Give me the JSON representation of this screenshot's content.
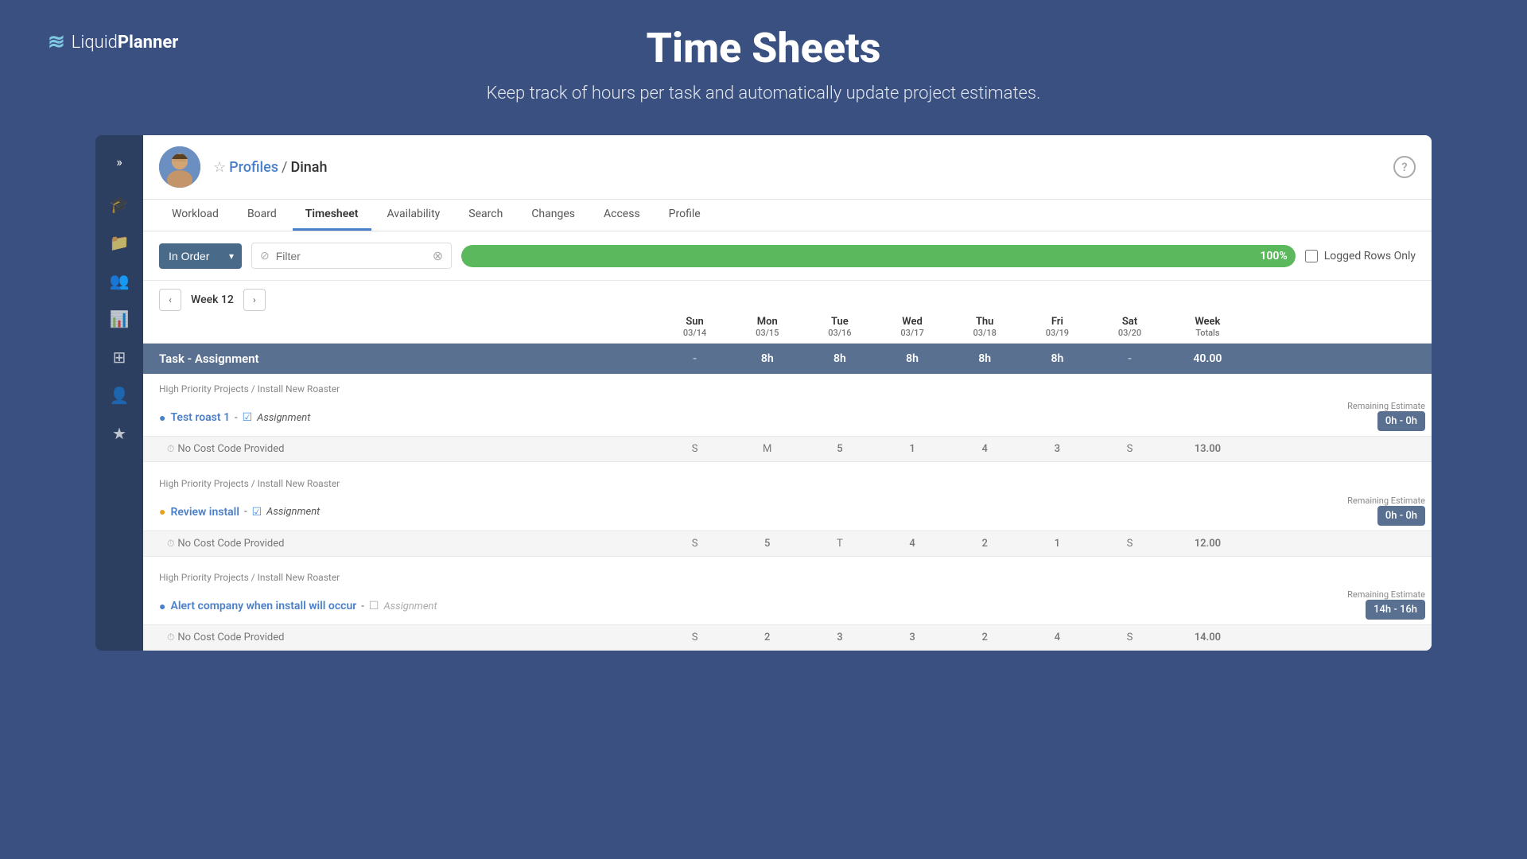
{
  "logo": {
    "waves": "≋",
    "liquid": "Liquid",
    "planner": "Planner"
  },
  "hero": {
    "title": "Time Sheets",
    "subtitle": "Keep track of hours per task and automatically update project estimates."
  },
  "sidebar": {
    "chevron": "»",
    "icons": [
      "🎓",
      "📁",
      "👥",
      "📊",
      "⊞",
      "👤",
      "★"
    ]
  },
  "profile": {
    "breadcrumb_profiles": "Profiles",
    "breadcrumb_sep": "/",
    "breadcrumb_name": "Dinah"
  },
  "tabs": [
    {
      "label": "Workload",
      "active": false
    },
    {
      "label": "Board",
      "active": false
    },
    {
      "label": "Timesheet",
      "active": true
    },
    {
      "label": "Availability",
      "active": false
    },
    {
      "label": "Search",
      "active": false
    },
    {
      "label": "Changes",
      "active": false
    },
    {
      "label": "Access",
      "active": false
    },
    {
      "label": "Profile",
      "active": false
    }
  ],
  "toolbar": {
    "order_label": "In Order",
    "filter_placeholder": "Filter",
    "progress": 100,
    "progress_label": "100%",
    "logged_rows_label": "Logged Rows Only"
  },
  "week": {
    "label": "Week 12",
    "days": [
      {
        "name": "Sun",
        "date": "03/14"
      },
      {
        "name": "Mon",
        "date": "03/15"
      },
      {
        "name": "Tue",
        "date": "03/16"
      },
      {
        "name": "Wed",
        "date": "03/17"
      },
      {
        "name": "Thu",
        "date": "03/18"
      },
      {
        "name": "Fri",
        "date": "03/19"
      },
      {
        "name": "Sat",
        "date": "03/20"
      },
      {
        "name": "Week",
        "date": "Totals"
      }
    ]
  },
  "summary": {
    "label": "Task - Assignment",
    "sun": "-",
    "mon": "8h",
    "tue": "8h",
    "wed": "8h",
    "thu": "8h",
    "fri": "8h",
    "sat": "-",
    "total": "40.00"
  },
  "tasks": [
    {
      "id": 1,
      "path": "High Priority Projects / Install New Roaster",
      "name": "Test roast 1",
      "name_icon": "blue_circle",
      "assignment": "Assignment",
      "assignment_checked": true,
      "remaining_label": "Remaining Estimate",
      "remaining_badge": "0h - 0h",
      "cost_code": "No Cost Code Provided",
      "sun": "S",
      "mon": "M",
      "tue": "5",
      "wed": "1",
      "thu": "4",
      "fri": "3",
      "sat": "S",
      "total": "13.00"
    },
    {
      "id": 2,
      "path": "High Priority Projects / Install New Roaster",
      "name": "Review install",
      "name_icon": "orange_circle",
      "assignment": "Assignment",
      "assignment_checked": true,
      "remaining_label": "Remaining Estimate",
      "remaining_badge": "0h - 0h",
      "cost_code": "No Cost Code Provided",
      "sun": "S",
      "mon": "5",
      "tue": "T",
      "wed": "4",
      "thu": "2",
      "fri": "1",
      "sat": "S",
      "total": "12.00"
    },
    {
      "id": 3,
      "path": "High Priority Projects / Install New Roaster",
      "name": "Alert company when install will occur",
      "name_icon": "blue_circle",
      "assignment": "Assignment",
      "assignment_checked": false,
      "remaining_label": "Remaining Estimate",
      "remaining_badge": "14h - 16h",
      "cost_code": "No Cost Code Provided",
      "sun": "S",
      "mon": "2",
      "tue": "3",
      "wed": "3",
      "thu": "2",
      "fri": "4",
      "sat": "S",
      "total": "14.00"
    }
  ]
}
